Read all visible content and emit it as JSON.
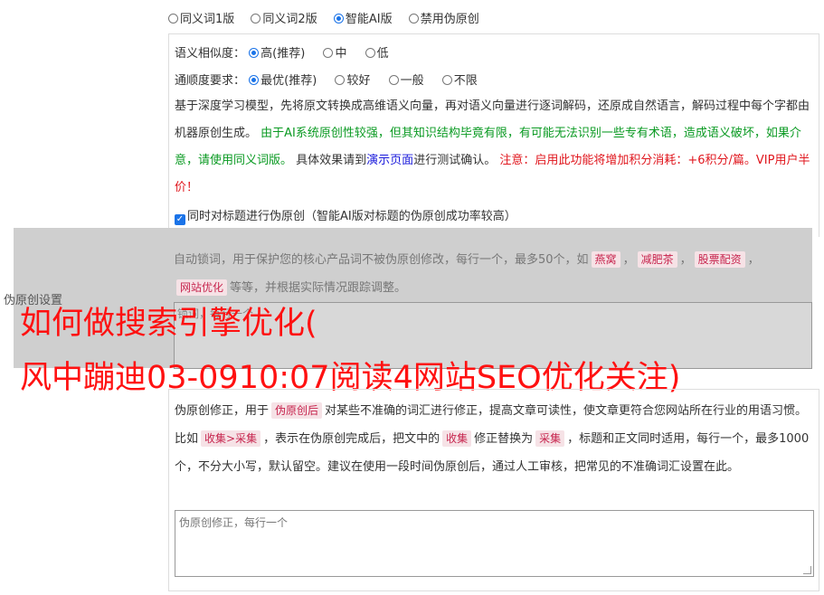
{
  "modes": [
    {
      "label": "同义词1版",
      "selected": false
    },
    {
      "label": "同义词2版",
      "selected": false
    },
    {
      "label": "智能AI版",
      "selected": true
    },
    {
      "label": "禁用伪原创",
      "selected": false
    }
  ],
  "similarity": {
    "label": "语义相似度：",
    "options": [
      {
        "label": "高(推荐)",
        "selected": true
      },
      {
        "label": "中",
        "selected": false
      },
      {
        "label": "低",
        "selected": false
      }
    ]
  },
  "fluency": {
    "label": "通顺度要求：",
    "options": [
      {
        "label": "最优(推荐)",
        "selected": true
      },
      {
        "label": "较好",
        "selected": false
      },
      {
        "label": "一般",
        "selected": false
      },
      {
        "label": "不限",
        "selected": false
      }
    ]
  },
  "description": {
    "part1": "基于深度学习模型，先将原文转换成高维语义向量，再对语义向量进行逐词解码，还原成自然语言，解码过程中每个字都由机器原创生成。",
    "green": "由于AI系统原创性较强，但其知识结构毕竟有限，有可能无法识别一些专有术语，造成语义破坏，如果介意，请使用同义词版。",
    "part2": "具体效果请到",
    "link": "演示页面",
    "part3": "进行测试确认。",
    "red": "注意：启用此功能将增加积分消耗：+6积分/篇。VIP用户半价！"
  },
  "title_checkbox": {
    "label": "同时对标题进行伪原创（智能AI版对标题的伪原创成功率较高）",
    "checked": true
  },
  "lock_words": {
    "intro": "自动锁词，用于保护您的核心产品词不被伪原创修改，每行一个，最多50个，如",
    "examples": [
      "燕窝",
      "减肥茶",
      "股票配资",
      "网站优化"
    ],
    "outro": "等等，并根据实际情况跟踪调整。",
    "placeholder": "锁词，每行一个"
  },
  "side_label": "伪原创设置",
  "headline": {
    "line1": "如何做搜索引擎优化(",
    "line2": "风中蹦迪03-0910:07阅读4网站SEO优化关注)"
  },
  "fix": {
    "p1": "伪原创修正，用于",
    "tag1": "伪原创后",
    "p2": "对某些不准确的词汇进行修正，提高文章可读性，使文章更符合您网站所在行业的用语习惯。比如",
    "tag2": "收集>采集",
    "p3": "，表示在伪原创完成后，把文中的",
    "tag3": "收集",
    "p4": "修正替换为",
    "tag4": "采集",
    "p5": "，标题和正文同时适用，每行一个，最多1000个，不分大小写，默认留空。建议在使用一段时间伪原创后，通过人工审核，把常见的不准确词汇设置在此。",
    "placeholder": "伪原创修正，每行一个"
  },
  "colors": {
    "accent": "#1a73e8",
    "green": "#0a9a22",
    "red": "#e0161d",
    "link": "#1a1adb"
  }
}
